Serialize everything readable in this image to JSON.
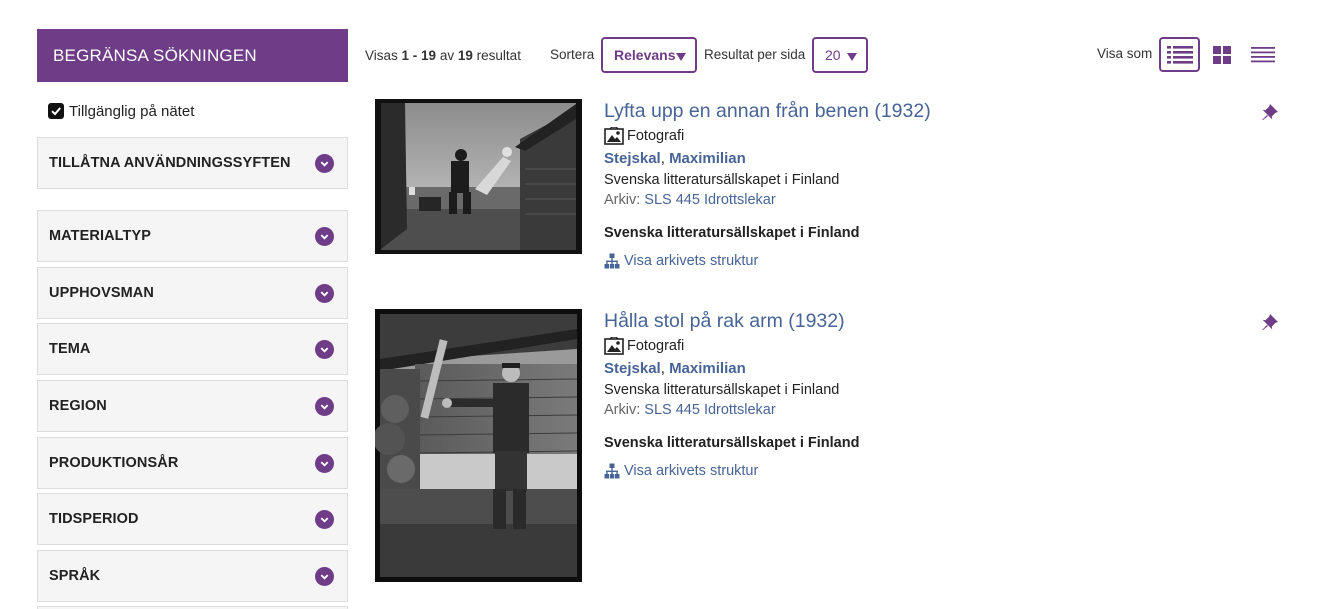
{
  "sidebar": {
    "header": "BEGRÄNSA SÖKNINGEN",
    "online_label": "Tillgänglig på nätet",
    "facets": [
      {
        "label": "TILLÅTNA ANVÄNDNINGSSYFTEN"
      },
      {
        "label": "MATERIALTYP"
      },
      {
        "label": "UPPHOVSMAN"
      },
      {
        "label": "TEMA"
      },
      {
        "label": "REGION"
      },
      {
        "label": "PRODUKTIONSÅR"
      },
      {
        "label": "TIDSPERIOD"
      },
      {
        "label": "SPRÅK"
      }
    ]
  },
  "toolbar": {
    "showing_prefix": "Visas",
    "range": "1 - 19",
    "of": "av",
    "total": "19",
    "results_word": "resultat",
    "sort_label": "Sortera",
    "sort_value": "Relevans",
    "per_page_label": "Resultat per sida",
    "per_page_value": "20",
    "view_label": "Visa som",
    "active_view": "list"
  },
  "results": [
    {
      "title": "Lyfta upp en annan från benen (1932)",
      "type": "Fotografi",
      "creator_last": "Stejskal",
      "creator_first": "Maximilian",
      "organization": "Svenska litteratursällskapet i Finland",
      "archive_prefix": "Arkiv:",
      "archive_link": "SLS 445 Idrottslekar",
      "org_bold": "Svenska litteratursällskapet i Finland",
      "structure_link": "Visa arkivets struktur"
    },
    {
      "title": "Hålla stol på rak arm (1932)",
      "type": "Fotografi",
      "creator_last": "Stejskal",
      "creator_first": "Maximilian",
      "organization": "Svenska litteratursällskapet i Finland",
      "archive_prefix": "Arkiv:",
      "archive_link": "SLS 445 Idrottslekar",
      "org_bold": "Svenska litteratursällskapet i Finland",
      "structure_link": "Visa arkivets struktur"
    }
  ],
  "colors": {
    "brand_purple": "#6f3c88",
    "link_blue": "#476496",
    "facet_bg": "#f5f5f5"
  },
  "icons": [
    "check-icon",
    "chevron-down-icon",
    "list-view-icon",
    "grid-view-icon",
    "compact-view-icon",
    "photo-icon",
    "pin-icon",
    "hierarchy-icon"
  ]
}
